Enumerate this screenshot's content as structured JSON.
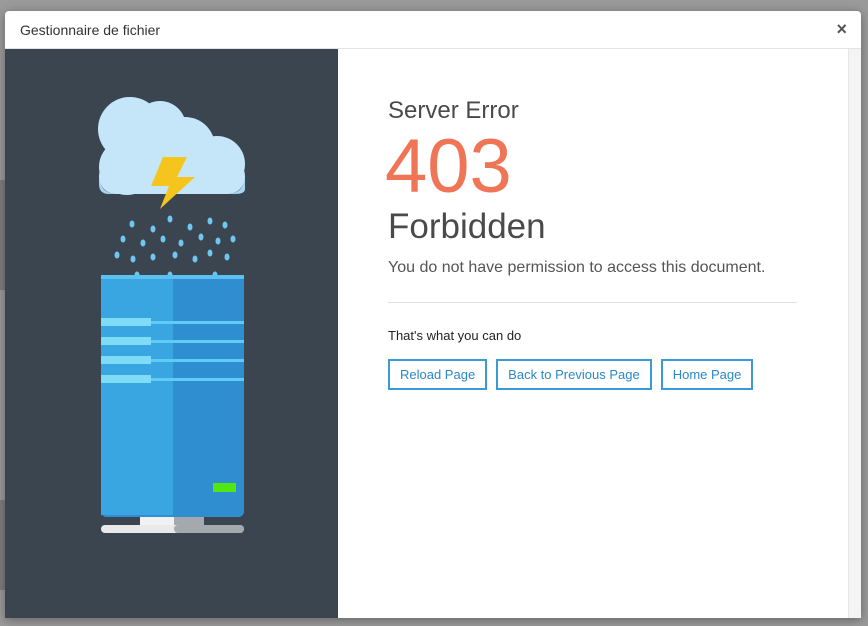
{
  "modal": {
    "title": "Gestionnaire de fichier",
    "close_label": "×"
  },
  "error": {
    "heading": "Server Error",
    "code": "403",
    "name": "Forbidden",
    "description": "You do not have permission to access this document."
  },
  "actions": {
    "prompt": "That's what you can do",
    "reload_label": "Reload Page",
    "back_label": "Back to Previous Page",
    "home_label": "Home Page"
  },
  "colors": {
    "panel_bg": "#3a4550",
    "accent": "#ef7556",
    "button_border": "#3a9ad9"
  },
  "icons": {
    "illustration": "server-rain-cloud-illustration"
  }
}
